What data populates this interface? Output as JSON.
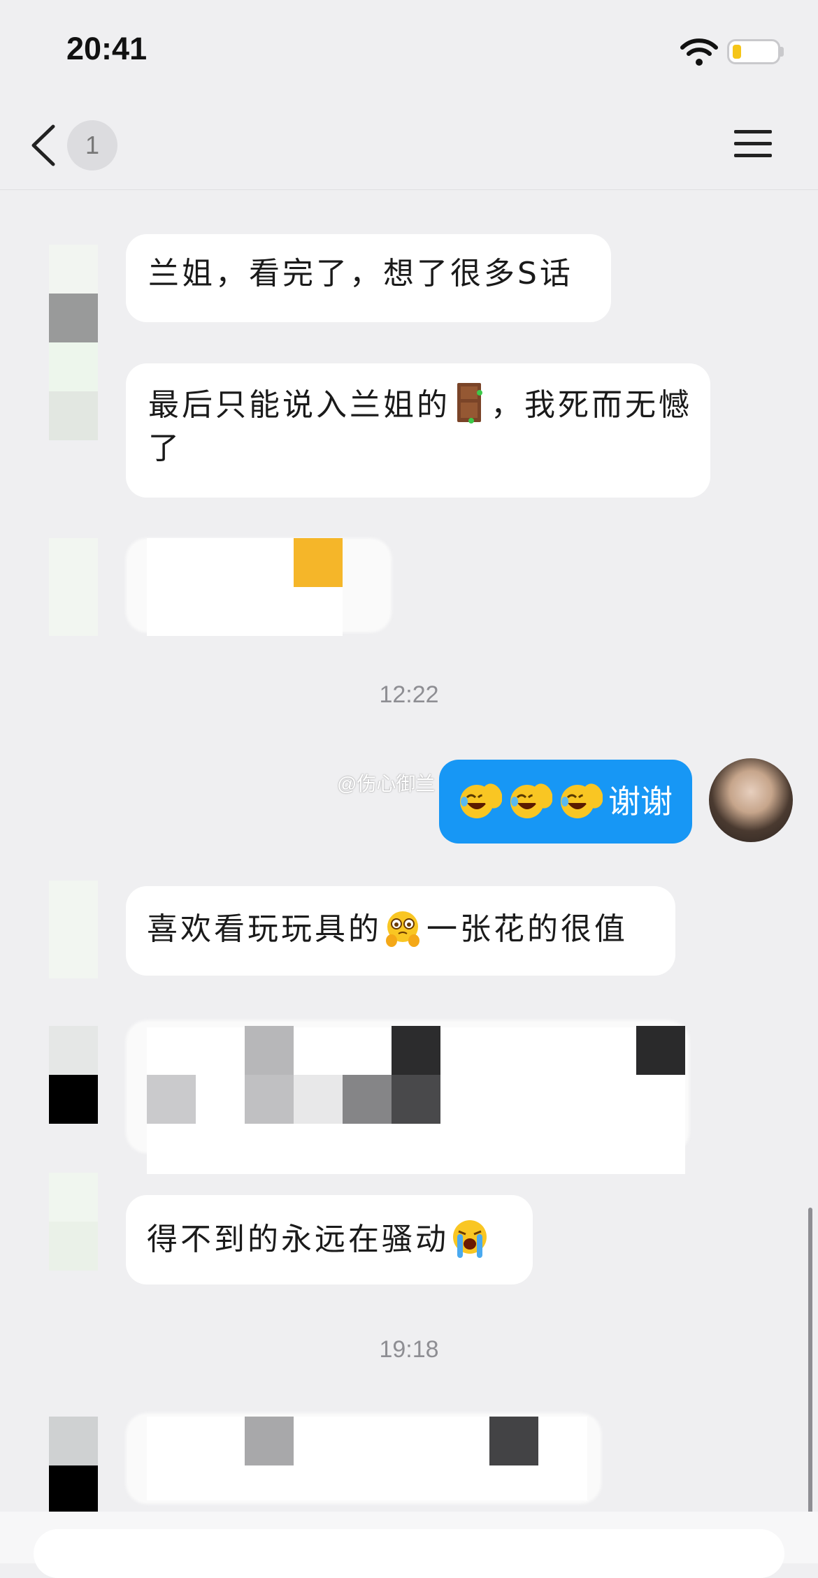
{
  "status_bar": {
    "time": "20:41"
  },
  "nav": {
    "unread_count": "1"
  },
  "messages": {
    "m1": "兰姐，看完了，想了很多S话",
    "m2_part1": "最后只能说入兰姐的",
    "m2_part2": "，我死而无憾了",
    "time1": "12:22",
    "sent": "谢谢",
    "m3_part1": "喜欢看玩玩具的",
    "m3_part2": "一张花的很值",
    "m4": "得不到的永远在骚动",
    "time2": "19:18"
  },
  "watermark": "@伤心御兰",
  "colors": {
    "sent_bubble": "#1797f5",
    "background": "#efeff1",
    "received_bubble": "#ffffff"
  },
  "icons": [
    "back-chevron-icon",
    "menu-icon",
    "wifi-icon",
    "battery-icon",
    "door-emoji",
    "laughing-crying-emoji",
    "pleading-emoji",
    "loudly-crying-emoji"
  ]
}
